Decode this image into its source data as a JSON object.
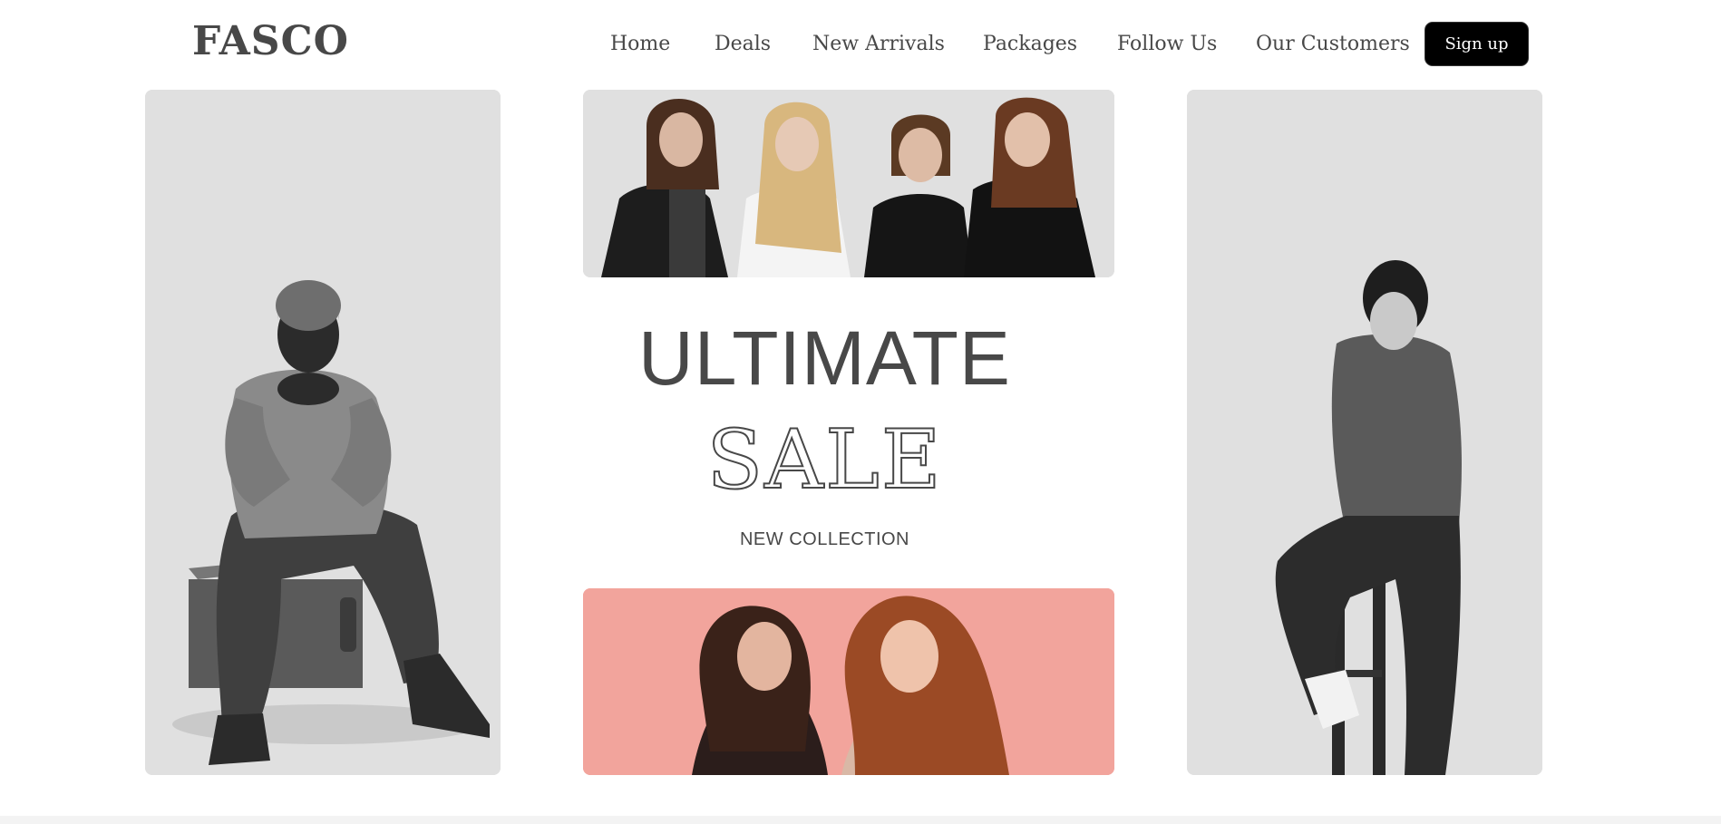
{
  "brand": {
    "logo": "FASCO"
  },
  "nav": {
    "items": [
      "Home",
      "Deals",
      "New Arrivals",
      "Packages",
      "Follow Us",
      "Our Customers"
    ],
    "signup_label": "Sign up"
  },
  "hero": {
    "headline_line1": "ULTIMATE",
    "headline_line2": "SALE",
    "subheadline": "NEW COLLECTION"
  },
  "images": {
    "left": "man-sitting-on-box-photo",
    "top": "four-women-group-photo",
    "bottom": "two-women-laughing-photo",
    "right": "man-on-stool-photo"
  },
  "colors": {
    "card_bg": "#e0e0e0",
    "accent_pink": "#f2a49c",
    "text": "#484848",
    "button_bg": "#000000"
  }
}
